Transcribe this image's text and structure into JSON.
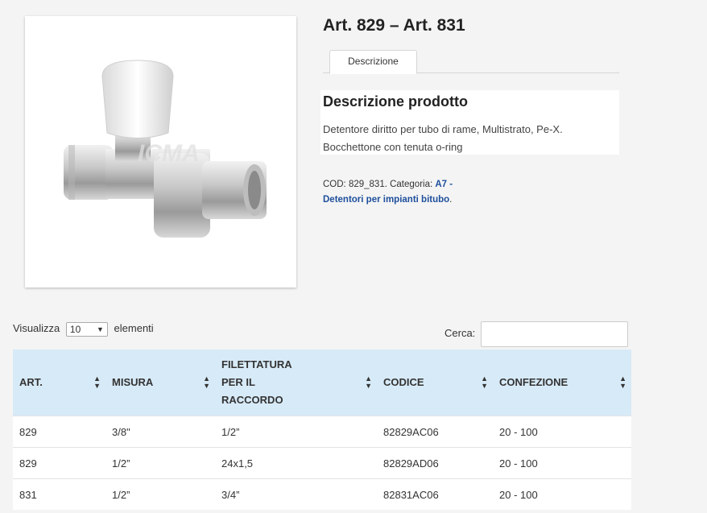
{
  "product": {
    "title": "Art. 829 – Art. 831",
    "image_logo": "ICMA"
  },
  "tabs": [
    {
      "label": "Descrizione"
    }
  ],
  "description": {
    "heading": "Descrizione prodotto",
    "line1": "Detentore diritto per tubo di rame, Multistrato, Pe-X.",
    "line2": "Bocchettone con tenuta o-ring"
  },
  "meta": {
    "cod_label": "COD: 829_831. Categoria: ",
    "category_link": "A7 - Detentori per impianti bitubo",
    "end": "."
  },
  "table_controls": {
    "show_label": "Visualizza",
    "show_value": "10",
    "elements_label": "elementi",
    "search_label": "Cerca:",
    "search_value": ""
  },
  "table": {
    "headers": [
      "ART.",
      "MISURA",
      "FILETTATURA PER IL RACCORDO",
      "CODICE",
      "CONFEZIONE"
    ],
    "header_sort_icon": "sort-icon",
    "rows": [
      [
        "829",
        "3/8\"",
        "1/2”",
        "82829AC06",
        "20 - 100"
      ],
      [
        "829",
        "1/2”",
        "24x1,5",
        "82829AD06",
        "20 - 100"
      ],
      [
        "831",
        "1/2”",
        "3/4”",
        "82831AC06",
        "20 - 100"
      ]
    ]
  },
  "colors": {
    "header_bg": "#d7eaf7",
    "link": "#1e4f9c",
    "page_bg": "#f4f4f4"
  }
}
